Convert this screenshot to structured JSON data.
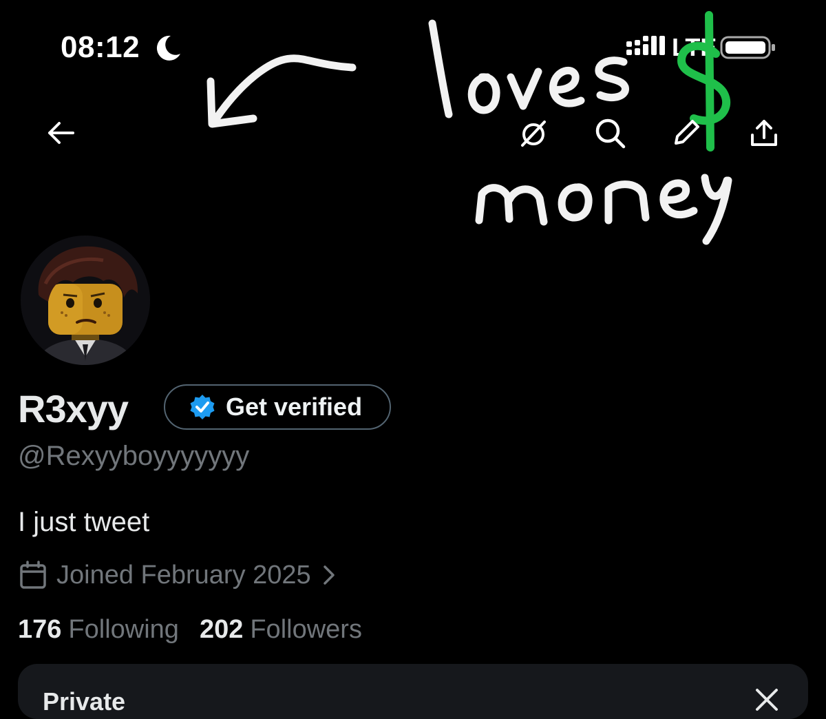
{
  "status_bar": {
    "time": "08:12",
    "network": "LTE",
    "icons": [
      "moon-icon",
      "signal-icon",
      "battery-icon"
    ]
  },
  "doodles": {
    "word_top": "loves",
    "symbol": "$",
    "word_bottom": "money",
    "ink_color": "#ffffff",
    "symbol_color": "#22c55e"
  },
  "nav": {
    "icons": [
      "back-arrow-icon",
      "grok-icon",
      "search-icon",
      "pencil-icon",
      "share-icon"
    ]
  },
  "profile": {
    "display_name": "R3xyy",
    "verify_label": "Get verified",
    "handle": "@Rexyyboyyyyyyy",
    "bio": "I just tweet",
    "joined": "Joined February 2025",
    "following_count": "176",
    "following_label": "Following",
    "followers_count": "202",
    "followers_label": "Followers"
  },
  "card": {
    "title": "Private"
  },
  "colors": {
    "background": "#000000",
    "primary_text": "#e7e9ea",
    "secondary_text": "#71767b",
    "verified_blue": "#1d9bf0",
    "card_bg": "#16181c"
  }
}
